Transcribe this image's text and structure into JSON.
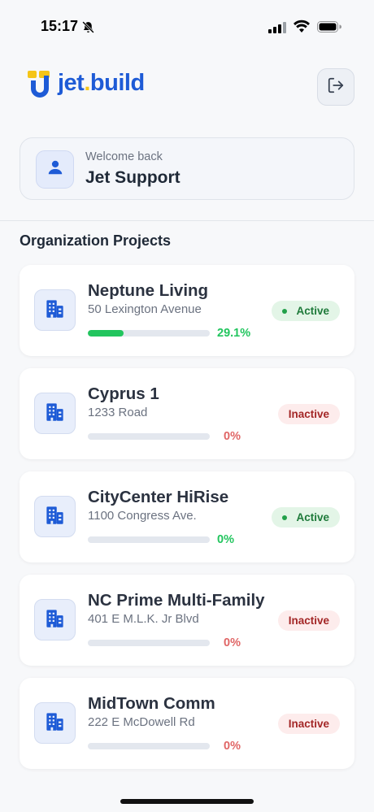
{
  "status_bar": {
    "time": "15:17"
  },
  "app": {
    "brand_main": "jet",
    "brand_dot": ".",
    "brand_suffix": "build"
  },
  "welcome": {
    "subtitle": "Welcome back",
    "name": "Jet Support"
  },
  "section_title": "Organization Projects",
  "projects": [
    {
      "name": "Neptune Living",
      "address": "50 Lexington Avenue",
      "progress": 0.291,
      "percent_label": "29.1%",
      "status": "Active"
    },
    {
      "name": "Cyprus 1",
      "address": "1233 Road",
      "progress": 0,
      "percent_label": "0%",
      "status": "Inactive"
    },
    {
      "name": "CityCenter HiRise",
      "address": "1100 Congress Ave.",
      "progress": 0,
      "percent_label": "0%",
      "status": "Active"
    },
    {
      "name": "NC Prime Multi-Family",
      "address": "401 E M.L.K. Jr Blvd",
      "progress": 0,
      "percent_label": "0%",
      "status": "Inactive"
    },
    {
      "name": "MidTown Comm",
      "address": "222 E McDowell Rd",
      "progress": 0,
      "percent_label": "0%",
      "status": "Inactive"
    }
  ],
  "colors": {
    "brand_blue": "#1e5bd6",
    "brand_yellow": "#f5c518",
    "active_green": "#22c55e",
    "inactive_red": "#e06666"
  },
  "icons": {
    "logout": "logout-icon",
    "user": "user-icon",
    "building": "building-icon"
  }
}
